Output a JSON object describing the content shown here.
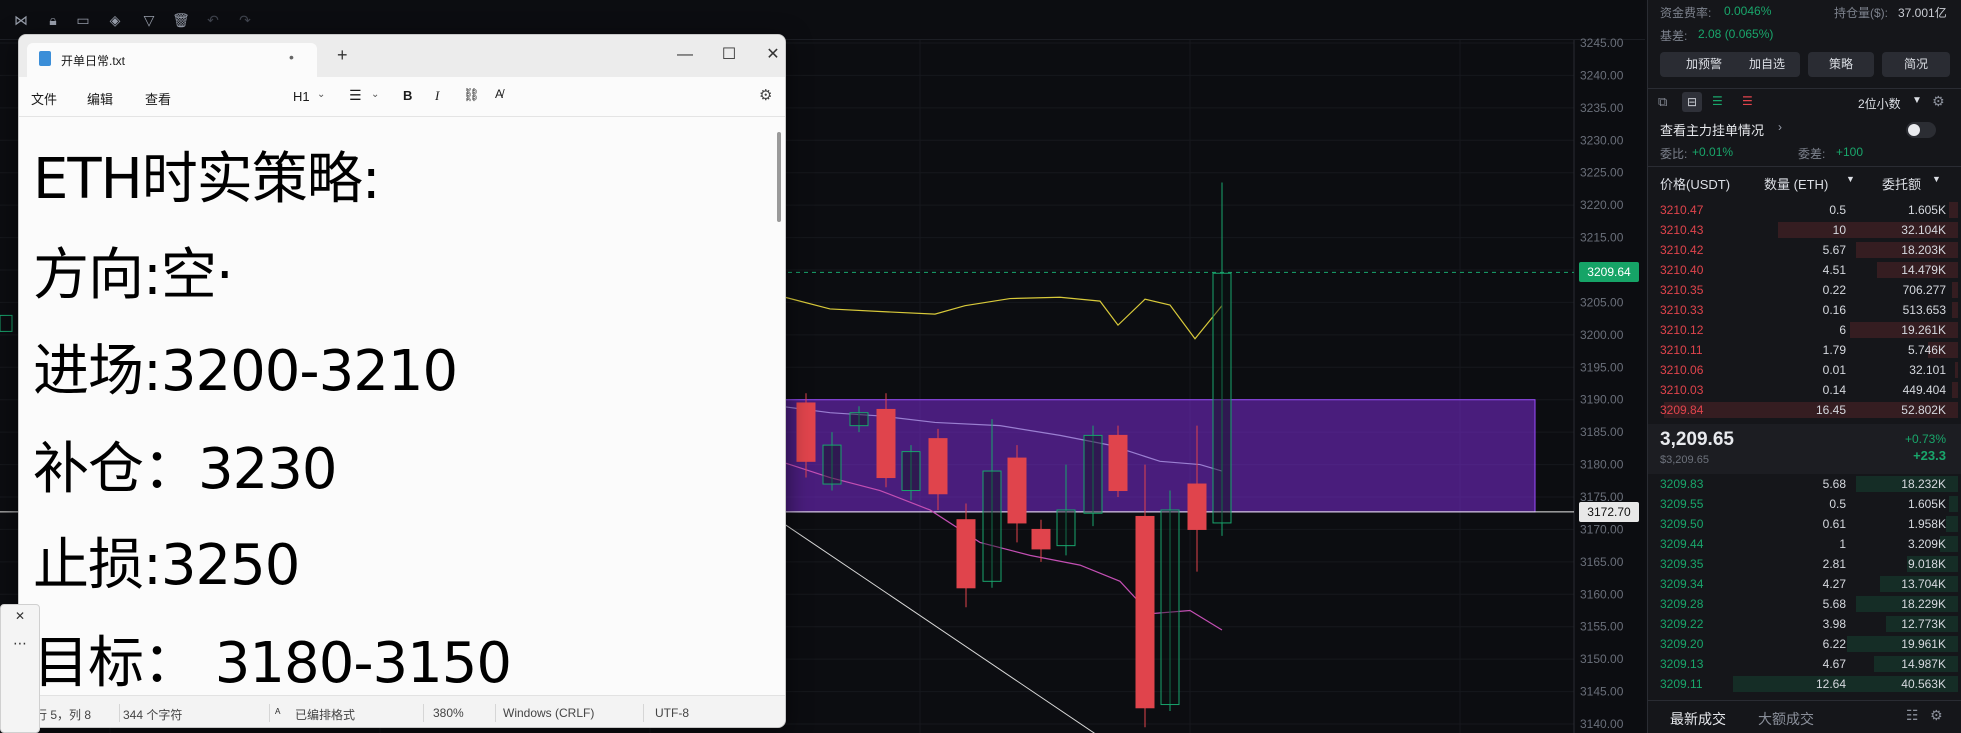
{
  "chart": {
    "price_axis": [
      "3245.00",
      "3240.00",
      "3235.00",
      "3230.00",
      "3225.00",
      "3220.00",
      "3215.00",
      "3210.00",
      "3205.00",
      "3200.00",
      "3195.00",
      "3190.00",
      "3185.00",
      "3180.00",
      "3175.00",
      "3170.00",
      "3165.00",
      "3160.00",
      "3155.00",
      "3150.00",
      "3145.00",
      "3140.00"
    ],
    "current_price_tag": "3209.64",
    "line_price_tag": "3172.70",
    "colors": {
      "up": "#18a56d",
      "down": "#e0444c",
      "box": "#7b2bd6",
      "ma_yellow": "#d8c93a",
      "ma_pink": "#c34fb3",
      "ma_violet": "#9a7fd1"
    }
  },
  "orderbook": {
    "funding_label": "资金费率:",
    "funding_value": "0.0046%",
    "oi_label": "持仓量($):",
    "oi_value": "37.001亿",
    "basis_label": "基差:",
    "basis_value": "2.08 (0.065%)",
    "buttons": [
      "加预警",
      "加自选",
      "策略",
      "简况"
    ],
    "precision": "2位小数",
    "main_orders_label": "查看主力挂单情况",
    "ratio_label": "委比:",
    "ratio_value": "+0.01%",
    "diff_label": "委差:",
    "diff_value": "+100",
    "headers": {
      "price": "价格(USDT)",
      "qty": "数量 (ETH)",
      "total": "委托额"
    },
    "asks": [
      {
        "p": "3210.47",
        "q": "0.5",
        "t": "1.605K",
        "d": 0.03
      },
      {
        "p": "3210.43",
        "q": "10",
        "t": "32.104K",
        "d": 0.6
      },
      {
        "p": "3210.42",
        "q": "5.67",
        "t": "18.203K",
        "d": 0.34
      },
      {
        "p": "3210.40",
        "q": "4.51",
        "t": "14.479K",
        "d": 0.27
      },
      {
        "p": "3210.35",
        "q": "0.22",
        "t": "706.277",
        "d": 0.02
      },
      {
        "p": "3210.33",
        "q": "0.16",
        "t": "513.653",
        "d": 0.02
      },
      {
        "p": "3210.12",
        "q": "6",
        "t": "19.261K",
        "d": 0.36
      },
      {
        "p": "3210.11",
        "q": "1.79",
        "t": "5.746K",
        "d": 0.1
      },
      {
        "p": "3210.06",
        "q": "0.01",
        "t": "32.101",
        "d": 0.01
      },
      {
        "p": "3210.03",
        "q": "0.14",
        "t": "449.404",
        "d": 0.02
      },
      {
        "p": "3209.84",
        "q": "16.45",
        "t": "52.802K",
        "d": 0.98
      }
    ],
    "last_price": "3,209.65",
    "last_price_usd": "$3,209.65",
    "change_pct": "+0.73%",
    "change_abs": "+23.3",
    "bids": [
      {
        "p": "3209.83",
        "q": "5.68",
        "t": "18.232K",
        "d": 0.34
      },
      {
        "p": "3209.55",
        "q": "0.5",
        "t": "1.605K",
        "d": 0.03
      },
      {
        "p": "3209.50",
        "q": "0.61",
        "t": "1.958K",
        "d": 0.04
      },
      {
        "p": "3209.44",
        "q": "1",
        "t": "3.209K",
        "d": 0.06
      },
      {
        "p": "3209.35",
        "q": "2.81",
        "t": "9.018K",
        "d": 0.17
      },
      {
        "p": "3209.34",
        "q": "4.27",
        "t": "13.704K",
        "d": 0.26
      },
      {
        "p": "3209.28",
        "q": "5.68",
        "t": "18.229K",
        "d": 0.34
      },
      {
        "p": "3209.22",
        "q": "3.98",
        "t": "12.773K",
        "d": 0.24
      },
      {
        "p": "3209.20",
        "q": "6.22",
        "t": "19.961K",
        "d": 0.37
      },
      {
        "p": "3209.13",
        "q": "4.67",
        "t": "14.987K",
        "d": 0.28
      },
      {
        "p": "3209.11",
        "q": "12.64",
        "t": "40.563K",
        "d": 0.75
      }
    ],
    "bottom_tabs": [
      "最新成交",
      "大额成交"
    ]
  },
  "notepad": {
    "tab_title": "开单日常.txt",
    "menu": [
      "文件",
      "编辑",
      "查看"
    ],
    "heading_select": "H1",
    "lines": [
      "ETH时实策略:",
      "方向:空·",
      "进场:3200-3210",
      "补仓：3230",
      "止损:3250",
      "目标：  3180-3150"
    ],
    "status": {
      "position": "行 5，列 8",
      "chars": "344 个字符",
      "format": "已编排格式",
      "zoom": "380%",
      "line_ending": "Windows (CRLF)",
      "encoding": "UTF-8"
    }
  }
}
